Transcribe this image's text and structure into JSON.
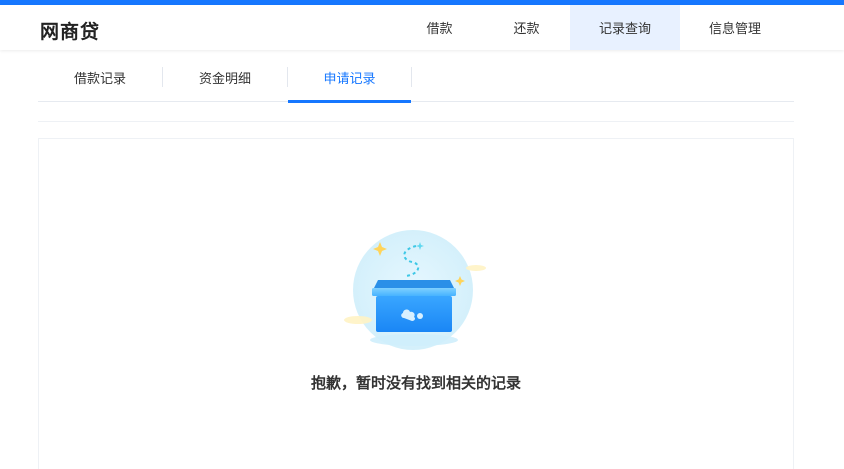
{
  "header": {
    "logo": "网商贷",
    "nav": [
      {
        "label": "借款",
        "active": false
      },
      {
        "label": "还款",
        "active": false
      },
      {
        "label": "记录查询",
        "active": true
      },
      {
        "label": "信息管理",
        "active": false
      }
    ]
  },
  "subtabs": [
    {
      "label": "借款记录",
      "active": false
    },
    {
      "label": "资金明细",
      "active": false
    },
    {
      "label": "申请记录",
      "active": true
    }
  ],
  "empty_state": {
    "message": "抱歉，暂时没有找到相关的记录",
    "icon": "empty-box-icon"
  },
  "colors": {
    "accent": "#1677ff",
    "active_nav_bg": "#e8f1ff",
    "text": "#333333"
  }
}
